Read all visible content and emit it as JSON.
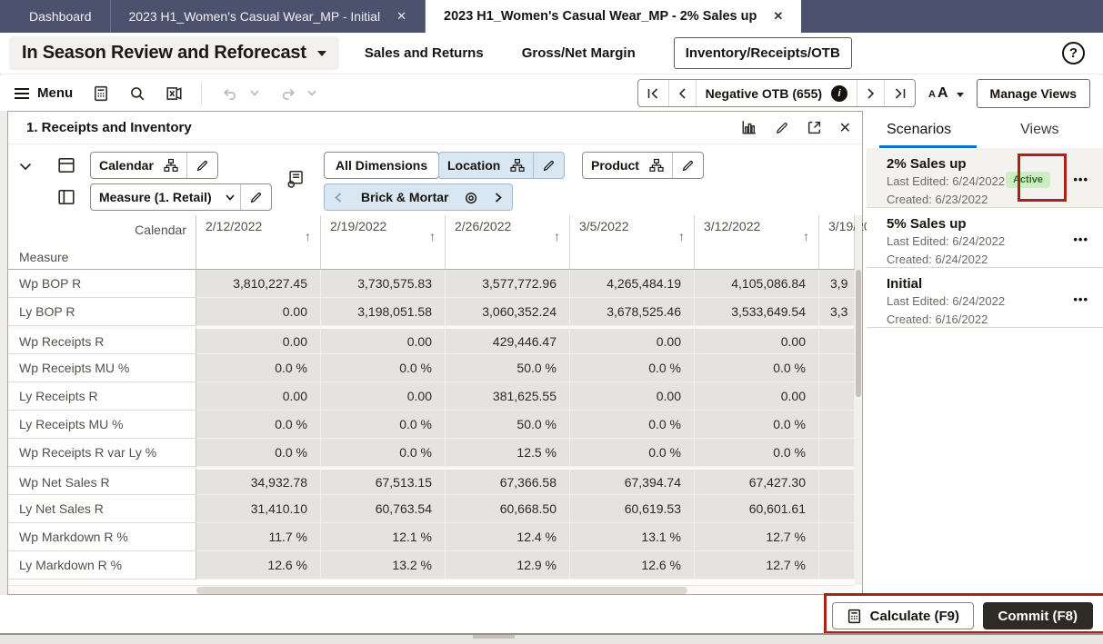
{
  "colors": {
    "topbar": "#4c516d",
    "accent_blue": "#1070c9",
    "tile_blue_bg": "#d9e7f3",
    "cell_bg": "#e5e3e0",
    "badge_green_bg": "#cdeec3",
    "badge_green_text": "#2f6b2a",
    "annotation_red": "#a6241a",
    "commit_button_bg": "#2e2a26"
  },
  "icons": {
    "close": "✕",
    "sort_asc": "↑",
    "target": "◎",
    "ellipsis": "•••",
    "info": "i",
    "help": "?"
  },
  "tabbar": {
    "tabs": [
      {
        "label": "Dashboard"
      },
      {
        "label": "2023 H1_Women's Casual Wear_MP - Initial",
        "closable": true
      },
      {
        "label": "2023 H1_Women's Casual Wear_MP - 2% Sales up",
        "closable": true,
        "active": true
      }
    ]
  },
  "subheader": {
    "workspace_label": "In Season Review and Reforecast",
    "tabs": [
      {
        "label": "Sales and Returns"
      },
      {
        "label": "Gross/Net Margin"
      },
      {
        "label": "Inventory/Receipts/OTB",
        "selected": true
      }
    ]
  },
  "toolbar": {
    "menu_label": "Menu",
    "alert_nav_label": "Negative OTB (655)",
    "font_control_small": "A",
    "font_control_large": "A",
    "manage_views_label": "Manage Views"
  },
  "view": {
    "title": "1. Receipts and Inventory",
    "row_axis_label": "Calendar",
    "col_axis_label": "Measure (1. Retail)",
    "all_dimensions_label": "All Dimensions",
    "location_tile_label": "Location",
    "product_tile_label": "Product",
    "page_slice_label": "Brick & Mortar"
  },
  "grid": {
    "corner_label": "Calendar",
    "row_dim_label": "Measure",
    "columns": [
      "2/12/2022",
      "2/19/2022",
      "2/26/2022",
      "3/5/2022",
      "3/12/2022",
      "3/19/20"
    ],
    "rows": [
      {
        "label": "Wp BOP R",
        "values": [
          "3,810,227.45",
          "3,730,575.83",
          "3,577,772.96",
          "4,265,484.19",
          "4,105,086.84",
          "3,9"
        ]
      },
      {
        "label": "Ly BOP R",
        "values": [
          "0.00",
          "3,198,051.58",
          "3,060,352.24",
          "3,678,525.46",
          "3,533,649.54",
          "3,3"
        ]
      },
      {
        "label": "Wp Receipts R",
        "group_start": true,
        "values": [
          "0.00",
          "0.00",
          "429,446.47",
          "0.00",
          "0.00",
          ""
        ]
      },
      {
        "label": "Wp Receipts MU %",
        "values": [
          "0.0 %",
          "0.0 %",
          "50.0 %",
          "0.0 %",
          "0.0 %",
          ""
        ]
      },
      {
        "label": "Ly Receipts R",
        "values": [
          "0.00",
          "0.00",
          "381,625.55",
          "0.00",
          "0.00",
          ""
        ]
      },
      {
        "label": "Ly Receipts MU %",
        "values": [
          "0.0 %",
          "0.0 %",
          "50.0 %",
          "0.0 %",
          "0.0 %",
          ""
        ]
      },
      {
        "label": "Wp Receipts R var Ly %",
        "values": [
          "0.0 %",
          "0.0 %",
          "12.5 %",
          "0.0 %",
          "0.0 %",
          ""
        ]
      },
      {
        "label": "Wp Net Sales R",
        "group_start": true,
        "values": [
          "34,932.78",
          "67,513.15",
          "67,366.58",
          "67,394.74",
          "67,427.30",
          ""
        ]
      },
      {
        "label": "Ly Net Sales R",
        "values": [
          "31,410.10",
          "60,763.54",
          "60,668.50",
          "60,619.53",
          "60,601.61",
          ""
        ]
      },
      {
        "label": "Wp Markdown R %",
        "values": [
          "11.7 %",
          "12.1 %",
          "12.4 %",
          "13.1 %",
          "12.7 %",
          ""
        ]
      },
      {
        "label": "Ly Markdown R %",
        "values": [
          "12.6 %",
          "13.2 %",
          "12.9 %",
          "12.6 %",
          "12.7 %",
          ""
        ]
      }
    ]
  },
  "scenarios": {
    "tab_scenarios": "Scenarios",
    "tab_views": "Views",
    "cards": [
      {
        "title": "2% Sales up",
        "last_edited": "Last Edited: 6/24/2022",
        "created": "Created: 6/23/2022",
        "badge": "Active"
      },
      {
        "title": "5% Sales up",
        "last_edited": "Last Edited: 6/24/2022",
        "created": "Created: 6/24/2022"
      },
      {
        "title": "Initial",
        "last_edited": "Last Edited: 6/24/2022",
        "created": "Created: 6/16/2022"
      }
    ]
  },
  "footer": {
    "calculate_label": "Calculate (F9)",
    "commit_label": "Commit (F8)"
  }
}
